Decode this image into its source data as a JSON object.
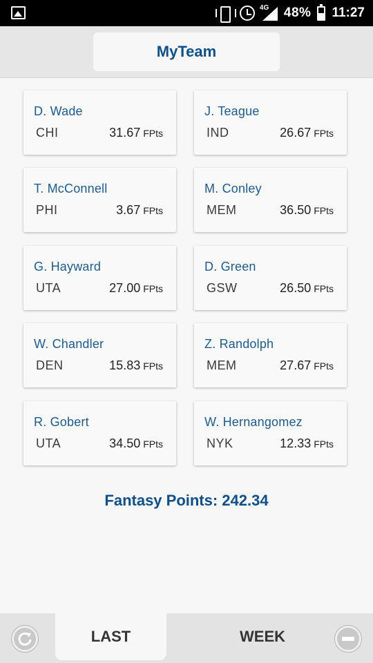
{
  "status_bar": {
    "network": "4G",
    "battery": "48%",
    "time": "11:27"
  },
  "header": {
    "title": "MyTeam"
  },
  "players": [
    {
      "name": "D. Wade",
      "team": "CHI",
      "points": "31.67",
      "unit": "FPts"
    },
    {
      "name": "J. Teague",
      "team": "IND",
      "points": "26.67",
      "unit": "FPts"
    },
    {
      "name": "T. McConnell",
      "team": "PHI",
      "points": "3.67",
      "unit": "FPts"
    },
    {
      "name": "M. Conley",
      "team": "MEM",
      "points": "36.50",
      "unit": "FPts"
    },
    {
      "name": "G. Hayward",
      "team": "UTA",
      "points": "27.00",
      "unit": "FPts"
    },
    {
      "name": "D. Green",
      "team": "GSW",
      "points": "26.50",
      "unit": "FPts"
    },
    {
      "name": "W. Chandler",
      "team": "DEN",
      "points": "15.83",
      "unit": "FPts"
    },
    {
      "name": "Z. Randolph",
      "team": "MEM",
      "points": "27.67",
      "unit": "FPts"
    },
    {
      "name": "R. Gobert",
      "team": "UTA",
      "points": "34.50",
      "unit": "FPts"
    },
    {
      "name": "W. Hernangomez",
      "team": "NYK",
      "points": "12.33",
      "unit": "FPts"
    }
  ],
  "summary": {
    "total_label": "Fantasy Points: 242.34"
  },
  "bottom_bar": {
    "tab_last": "LAST",
    "tab_week": "WEEK",
    "selected_tab": "LAST"
  },
  "colors": {
    "accent": "#0d4f8f",
    "player_name": "#1a5c97",
    "status_bar": "#000000",
    "header_bg": "#e6e6e6"
  }
}
